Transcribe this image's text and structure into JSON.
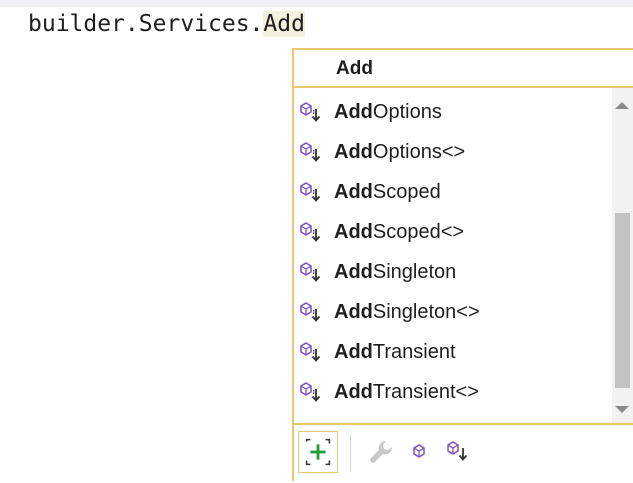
{
  "editor": {
    "code_prefix": "builder.Services.",
    "code_typed": "Add"
  },
  "completion": {
    "header": "Add",
    "items": [
      {
        "match": "Add",
        "rest": "Options",
        "icon": "extension-method-icon"
      },
      {
        "match": "Add",
        "rest": "Options<>",
        "icon": "extension-method-icon"
      },
      {
        "match": "Add",
        "rest": "Scoped",
        "icon": "extension-method-icon"
      },
      {
        "match": "Add",
        "rest": "Scoped<>",
        "icon": "extension-method-icon"
      },
      {
        "match": "Add",
        "rest": "Singleton",
        "icon": "extension-method-icon"
      },
      {
        "match": "Add",
        "rest": "Singleton<>",
        "icon": "extension-method-icon"
      },
      {
        "match": "Add",
        "rest": "Transient",
        "icon": "extension-method-icon"
      },
      {
        "match": "Add",
        "rest": "Transient<>",
        "icon": "extension-method-icon"
      }
    ],
    "toolbar_icons": [
      "expand-icon",
      "wrench-icon",
      "method-icon",
      "extension-method-icon"
    ]
  },
  "colors": {
    "accent_border": "#e7c974",
    "icon_purple": "#7a4fc8",
    "typed_highlight": "#f3f2de"
  }
}
